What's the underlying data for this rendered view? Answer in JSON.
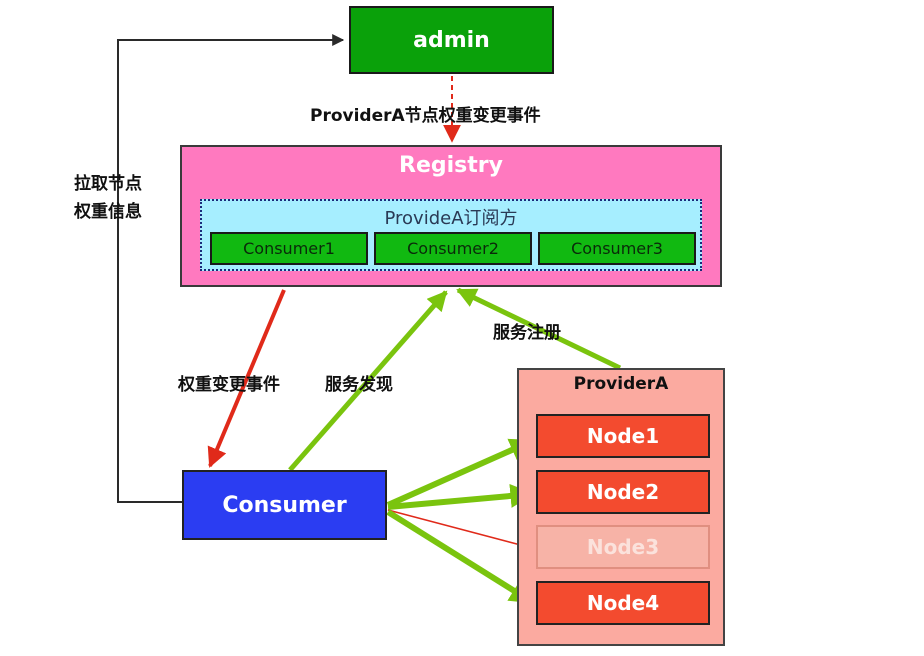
{
  "nodes": {
    "admin": "admin",
    "registry": "Registry",
    "subscribers_title": "ProvideA订阅方",
    "subscriber_consumers": [
      "Consumer1",
      "Consumer2",
      "Consumer3"
    ],
    "consumer": "Consumer",
    "provider": "ProviderA",
    "provider_nodes": [
      "Node1",
      "Node2",
      "Node3",
      "Node4"
    ]
  },
  "edge_labels": {
    "weight_change_event_admin": "ProviderA节点权重变更事件",
    "pull_weight_line1": "拉取节点",
    "pull_weight_line2": "权重信息",
    "weight_change_event": "权重变更事件",
    "service_discovery": "服务发现",
    "service_registration": "服务注册"
  },
  "colors": {
    "green": "#0aa10a",
    "pink": "#ff79bf",
    "light_blue": "#a6eeff",
    "blue": "#2b3df2",
    "salmon": "#fbaaa0",
    "red_node": "#f34b2f",
    "arrow_red": "#e02a1a",
    "arrow_green": "#7ac40e",
    "arrow_gray": "#2a2a2a"
  }
}
